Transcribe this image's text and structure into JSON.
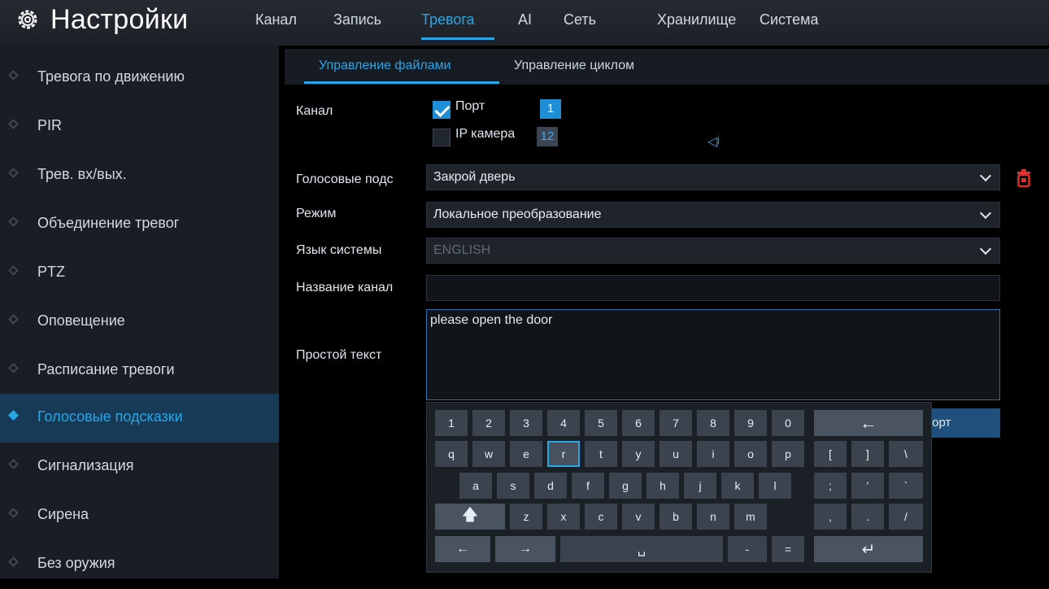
{
  "header": {
    "title": "Настройки",
    "tabs": [
      {
        "label": "Канал",
        "active": false
      },
      {
        "label": "Запись",
        "active": false
      },
      {
        "label": "Тревога",
        "active": true
      },
      {
        "label": "AI",
        "active": false
      },
      {
        "label": "Сеть",
        "active": false
      },
      {
        "label": "Хранилище",
        "active": false
      },
      {
        "label": "Система",
        "active": false
      }
    ]
  },
  "sidebar": {
    "items": [
      {
        "label": "Тревога по движению",
        "active": false
      },
      {
        "label": "PIR",
        "active": false
      },
      {
        "label": "Трев. вх/вых.",
        "active": false
      },
      {
        "label": "Объединение тревог",
        "active": false
      },
      {
        "label": "PTZ",
        "active": false
      },
      {
        "label": "Оповещение",
        "active": false
      },
      {
        "label": "Расписание тревоги",
        "active": false
      },
      {
        "label": "Голосовые подсказки",
        "active": true
      },
      {
        "label": "Сигнализация",
        "active": false
      },
      {
        "label": "Сирена",
        "active": false
      },
      {
        "label": "Без оружия",
        "active": false
      }
    ]
  },
  "subtabs": [
    {
      "label": "Управление файлами",
      "active": true
    },
    {
      "label": "Управление циклом",
      "active": false
    }
  ],
  "form": {
    "channel_label": "Канал",
    "port_label": "Порт",
    "port_checked": true,
    "port_count": "1",
    "ipcam_label": "IP камера",
    "ipcam_checked": false,
    "ipcam_count": "12",
    "voice_label": "Голосовые подс",
    "voice_value": "Закрой дверь",
    "mode_label": "Режим",
    "mode_value": "Локальное преобразование",
    "lang_label": "Язык системы",
    "lang_value": "ENGLISH",
    "name_label": "Название канал",
    "name_value": "",
    "text_label": "Простой текст",
    "text_value": "please open the door",
    "import_label": "порт"
  },
  "keyboard": {
    "row1": [
      "1",
      "2",
      "3",
      "4",
      "5",
      "6",
      "7",
      "8",
      "9",
      "0"
    ],
    "row2": [
      "q",
      "w",
      "e",
      "r",
      "t",
      "y",
      "u",
      "i",
      "o",
      "p"
    ],
    "row3": [
      "a",
      "s",
      "d",
      "f",
      "g",
      "h",
      "j",
      "k",
      "l"
    ],
    "row4": [
      "z",
      "x",
      "c",
      "v",
      "b",
      "n",
      "m"
    ],
    "symbols_row2": [
      "[",
      "]",
      "\\"
    ],
    "symbols_row3": [
      ";",
      "'",
      "`"
    ],
    "symbols_row4": [
      ",",
      ".",
      "/"
    ],
    "minus": "-",
    "equals": "=",
    "highlighted_key": "r"
  },
  "colors": {
    "accent": "#2aa5e6",
    "active_sidebar_bg": "#173a56",
    "checkbox_checked": "#1e8fd6",
    "delete_icon": "#e0302b"
  }
}
